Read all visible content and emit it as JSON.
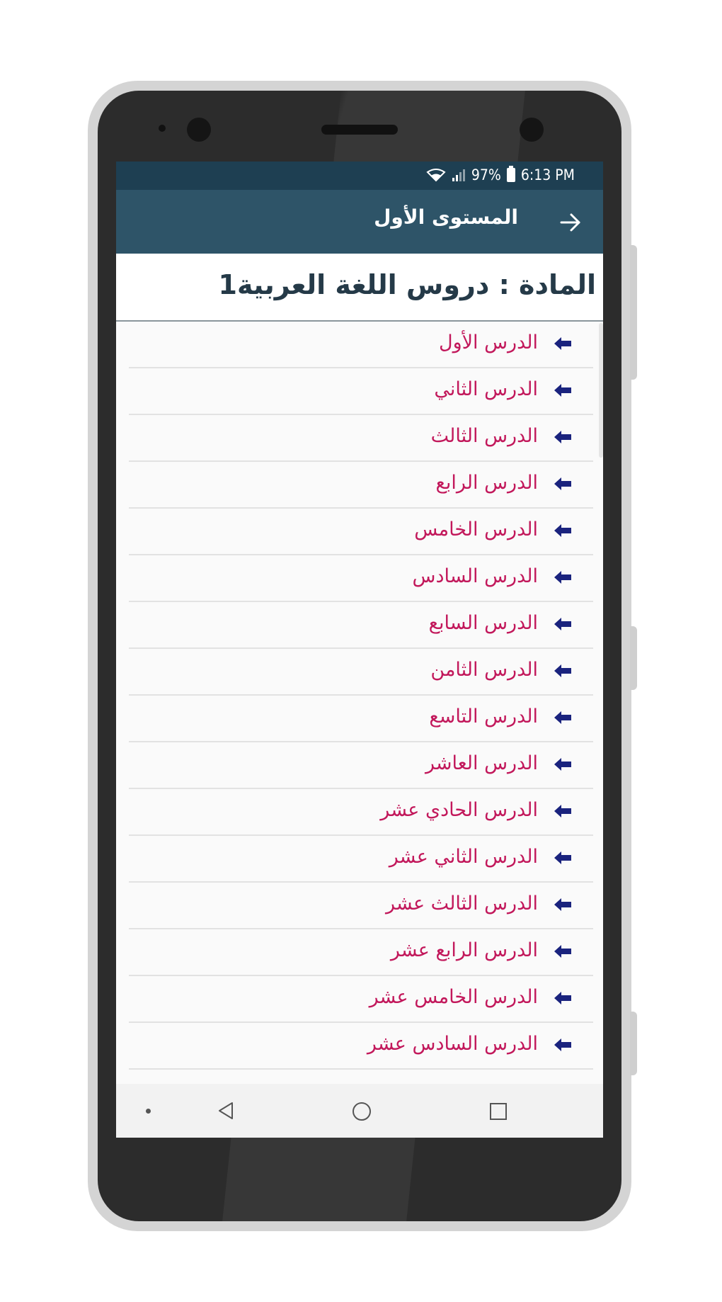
{
  "status_bar": {
    "battery": "97%",
    "time": "6:13 PM",
    "icons": [
      "wifi-icon",
      "signal-icon",
      "battery-icon"
    ]
  },
  "app_bar": {
    "title": "المستوى الأول",
    "back_icon": "arrow-right-icon"
  },
  "subject": {
    "title": "المادة : دروس اللغة العربية1"
  },
  "lessons": [
    {
      "label": "الدرس الأول"
    },
    {
      "label": "الدرس الثاني"
    },
    {
      "label": "الدرس الثالث"
    },
    {
      "label": "الدرس الرابع"
    },
    {
      "label": "الدرس الخامس"
    },
    {
      "label": "الدرس السادس"
    },
    {
      "label": "الدرس السابع"
    },
    {
      "label": "الدرس الثامن"
    },
    {
      "label": "الدرس التاسع"
    },
    {
      "label": "الدرس العاشر"
    },
    {
      "label": "الدرس الحادي عشر"
    },
    {
      "label": "الدرس الثاني عشر"
    },
    {
      "label": "الدرس الثالث عشر"
    },
    {
      "label": "الدرس الرابع عشر"
    },
    {
      "label": "الدرس الخامس عشر"
    },
    {
      "label": "الدرس السادس عشر"
    }
  ],
  "nav_bar": {
    "icons": [
      "dot-icon",
      "back-triangle-icon",
      "home-circle-icon",
      "recents-square-icon"
    ]
  },
  "colors": {
    "status_bar": "#1e3f52",
    "app_bar": "#2e5468",
    "subject_title": "#253a48",
    "lesson_text": "#c2185b",
    "lesson_arrow": "#1a237e"
  }
}
